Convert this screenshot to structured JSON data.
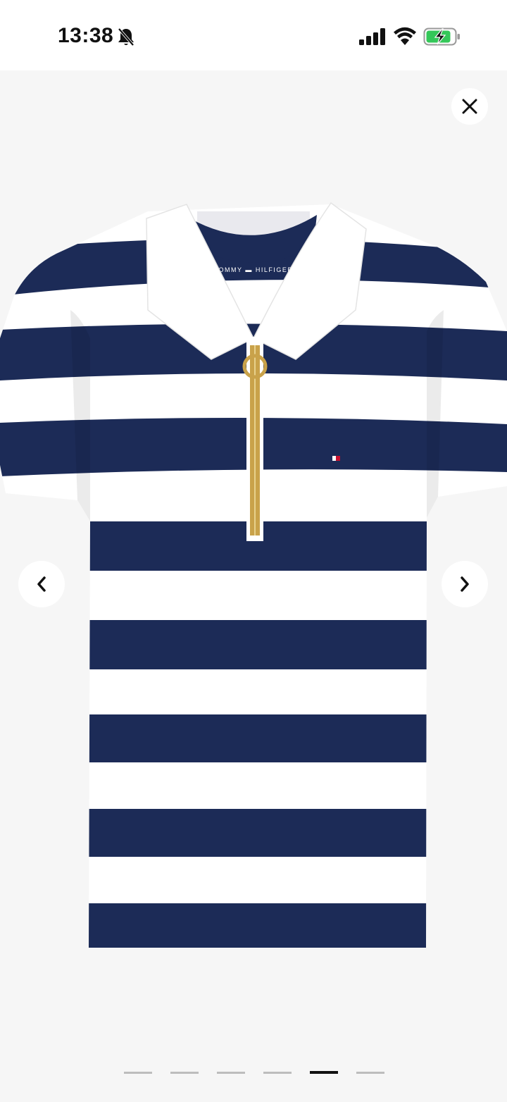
{
  "status_bar": {
    "time": "13:38",
    "icons": [
      "bell-slash-icon",
      "cellular-signal-icon",
      "wifi-icon",
      "battery-charging-icon"
    ],
    "battery_color": "#34c759"
  },
  "product": {
    "brand_label": "TOMMY HILFIGER",
    "image": "striped-zip-polo-shirt",
    "colors": {
      "navy": "#1c2b57",
      "white": "#ffffff",
      "zip": "#c9a24a",
      "background": "#f6f6f6"
    }
  },
  "controls": {
    "close_icon": "close-icon",
    "prev_icon": "chevron-left-icon",
    "next_icon": "chevron-right-icon"
  },
  "pagination": {
    "total": 6,
    "active_index": 4
  }
}
